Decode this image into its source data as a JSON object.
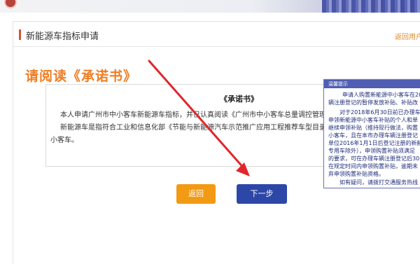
{
  "page": {
    "title": "新能源车指标申请",
    "back_link": "返回用户",
    "read_heading": "请阅读《承诺书》"
  },
  "letter": {
    "title": "《承诺书》",
    "lines": [
      "本人申请广州市中小客车新能源车指标，并已认真阅读《广州市中小客车总量调控管理办法》，并",
      "新能源车是指符合工业和信息化部《节能与新能源汽车示范推广应用工程推荐车型目录》所列的纯",
      "小客车。"
    ]
  },
  "buttons": {
    "back": "返回",
    "next": "下一步"
  },
  "popup": {
    "title": "温馨提示",
    "lines": [
      "申请人购置新能源中小客车在20",
      "辆注册登记的暂停发放补贴、补贴改",
      "对于2018年6月30日前已办理车",
      "申领新能源中小客车补贴的个人和单",
      "继续申领补贴（维持现行做法，购置",
      "小客车，且在本市办理车辆注册登记",
      "单位2016年1月1日后登记注册的新能",
      "专用车除外），申领购置补贴须满足",
      "的要求，可在办理车辆注册登记后30",
      "在规定时间内申领购置补贴，逾期未",
      "弃申领购置补贴资格。",
      "如有疑问，请拨打交通服务热线"
    ]
  },
  "colors": {
    "accent_orange": "#ef7d22",
    "button_back": "#f39a14",
    "button_next": "#2d47a7",
    "arrow": "#e0262b",
    "popup_header": "#4f5eb2"
  }
}
